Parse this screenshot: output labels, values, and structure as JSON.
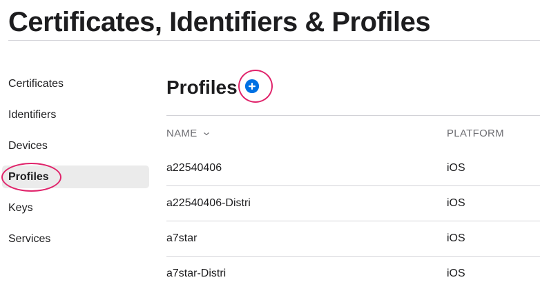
{
  "page_title": "Certificates, Identifiers & Profiles",
  "sidebar": {
    "items": [
      {
        "label": "Certificates"
      },
      {
        "label": "Identifiers"
      },
      {
        "label": "Devices"
      },
      {
        "label": "Profiles",
        "active": true
      },
      {
        "label": "Keys"
      },
      {
        "label": "Services"
      }
    ]
  },
  "section": {
    "title": "Profiles",
    "add_icon": "plus-circle-icon"
  },
  "table": {
    "columns": {
      "name": "NAME",
      "platform": "PLATFORM"
    },
    "sort_icon": "chevron-down-icon",
    "rows": [
      {
        "name": "a22540406",
        "platform": "iOS"
      },
      {
        "name": "a22540406-Distri",
        "platform": "iOS"
      },
      {
        "name": "a7star",
        "platform": "iOS"
      },
      {
        "name": "a7star-Distri",
        "platform": "iOS"
      }
    ]
  },
  "colors": {
    "accent": "#0071e3",
    "highlight": "#e0246b",
    "active_bg": "#ebebeb",
    "divider": "#d2d2d7"
  }
}
